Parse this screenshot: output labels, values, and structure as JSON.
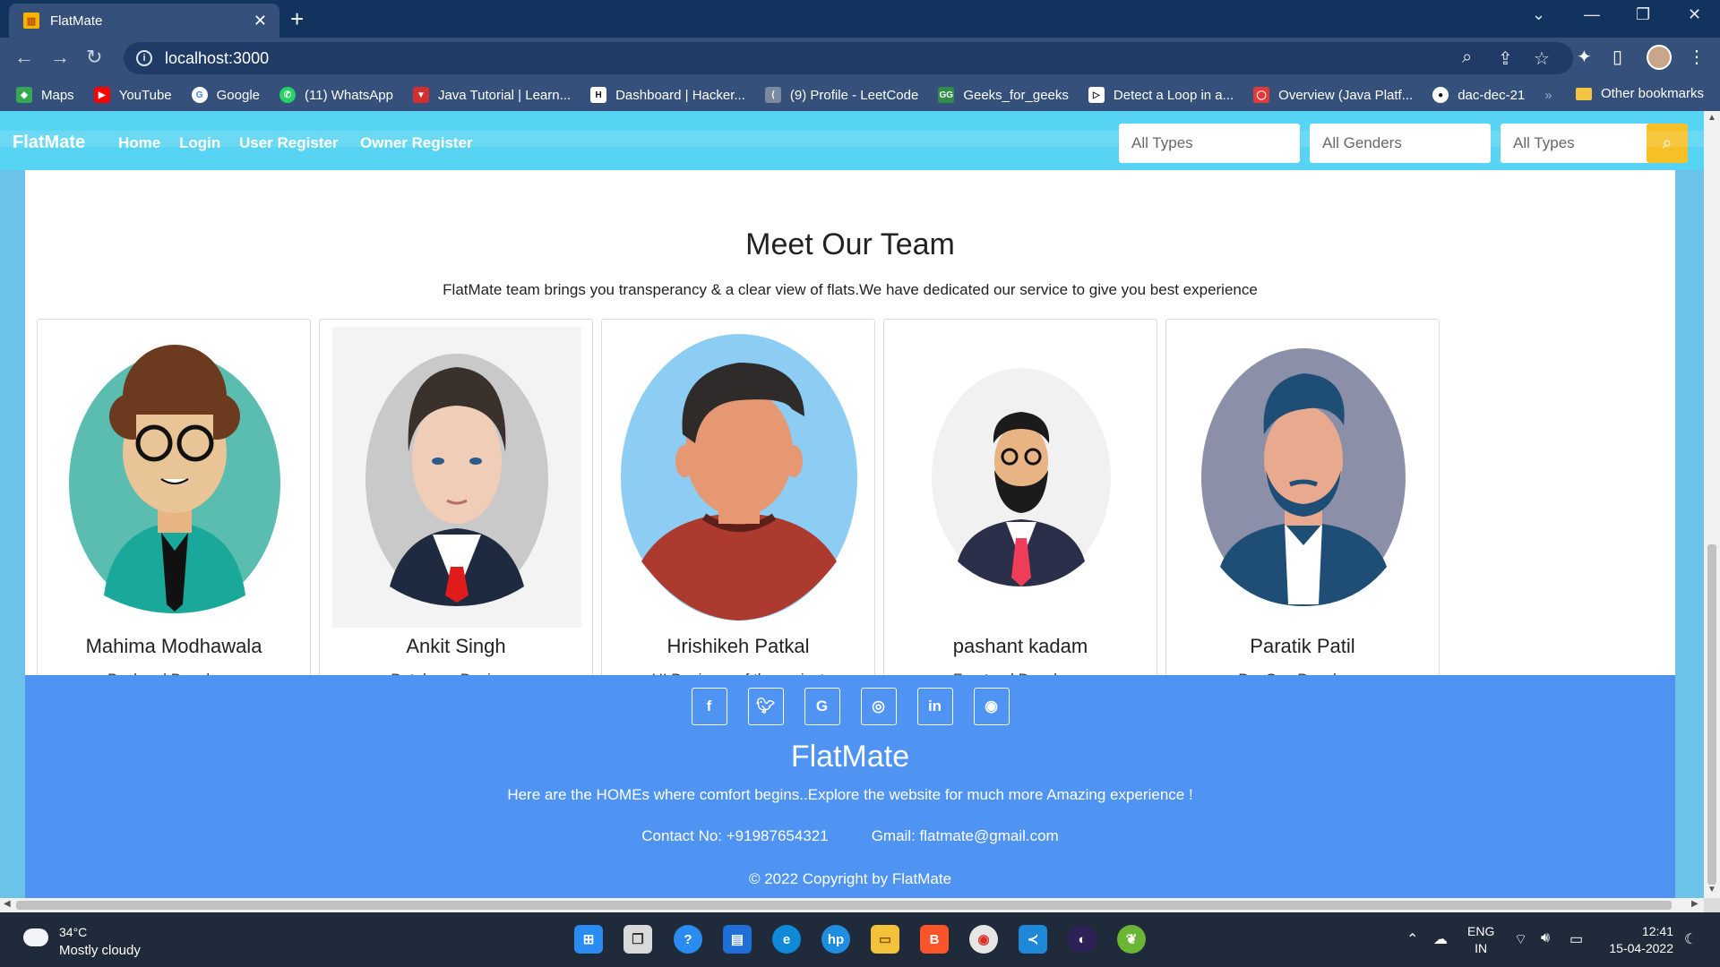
{
  "browser": {
    "tab_title": "FlatMate",
    "new_tab_symbol": "+",
    "url": "localhost:3000",
    "bookmarks": [
      {
        "label": "Maps",
        "color": "#34a853"
      },
      {
        "label": "YouTube",
        "color": "#ff0000"
      },
      {
        "label": "Google",
        "color": "#4285f4"
      },
      {
        "label": "(11) WhatsApp",
        "color": "#25d366"
      },
      {
        "label": "Java Tutorial | Learn...",
        "color": "#d32f2f"
      },
      {
        "label": "Dashboard | Hacker...",
        "color": "#111111"
      },
      {
        "label": "(9) Profile - LeetCode",
        "color": "#7a8aa0"
      },
      {
        "label": "Geeks_for_geeks",
        "color": "#2f8d46"
      },
      {
        "label": "Detect a Loop in a...",
        "color": "#111111"
      },
      {
        "label": "Overview (Java Platf...",
        "color": "#e53935"
      },
      {
        "label": "dac-dec-21",
        "color": "#111111"
      }
    ],
    "other_bookmarks": "Other bookmarks",
    "overflow_chevron": "»"
  },
  "site": {
    "brand": "FlatMate",
    "nav": [
      "Home",
      "Login",
      "User Register",
      "Owner Register"
    ],
    "filters": [
      "All Types",
      "All Genders",
      "All Types"
    ],
    "accent": "#57d4f3",
    "search_color": "#f6c026"
  },
  "team": {
    "title": "Meet Our Team",
    "description": "FlatMate team brings you transperancy & a clear view of flats.We have dedicated our service to give you best experience",
    "members": [
      {
        "name": "Mahima Modhawala",
        "role": "Backend Developer"
      },
      {
        "name": "Ankit Singh",
        "role": "Database Designer"
      },
      {
        "name": "Hrishikeh Patkal",
        "role": "UI Designer of the project"
      },
      {
        "name": "pashant kadam",
        "role": "Frontend Developer"
      },
      {
        "name": "Paratik Patil",
        "role": "DevOps Developer"
      }
    ]
  },
  "footer": {
    "socials": [
      "f",
      "t",
      "G",
      "ig",
      "in",
      "gh"
    ],
    "brand": "FlatMate",
    "tagline": "Here are the HOMEs where comfort begins..Explore the website for much more Amazing experience !",
    "contact": "Contact No: +91987654321",
    "gmail": "Gmail: flatmate@gmail.com",
    "copyright": "© 2022 Copyright by FlatMate",
    "color": "#5094f3"
  },
  "taskbar": {
    "temp": "34°C",
    "weather": "Mostly cloudy",
    "lang_1": "ENG",
    "lang_2": "IN",
    "time": "12:41",
    "date": "15-04-2022"
  }
}
